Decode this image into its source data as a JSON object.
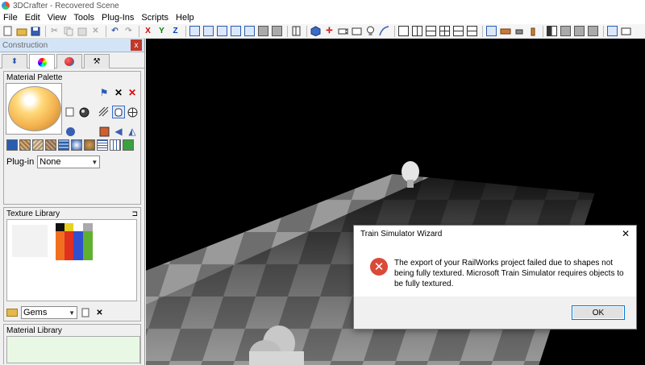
{
  "window": {
    "title": "3DCrafter - Recovered Scene"
  },
  "menu": [
    "File",
    "Edit",
    "View",
    "Tools",
    "Plug-Ins",
    "Scripts",
    "Help"
  ],
  "toolbar": {
    "buttons": [
      "new-icon",
      "open-icon",
      "save-icon",
      "cut-icon",
      "copy-icon",
      "paste-icon",
      "delete-icon",
      "undo-icon",
      "redo-icon"
    ],
    "axes": {
      "x": "X",
      "y": "Y",
      "z": "Z"
    },
    "colors": {
      "x": "#d40000",
      "y": "#008000",
      "z": "#0040c0"
    }
  },
  "panel": {
    "title": "Construction",
    "close": "x",
    "material_palette": {
      "label": "Material Palette",
      "plugin_label": "Plug-in",
      "plugin_value": "None"
    },
    "texture_library": {
      "label": "Texture Library",
      "selected": "Gems"
    },
    "material_library": {
      "label": "Material Library"
    }
  },
  "dialog": {
    "title": "Train Simulator Wizard",
    "close": "✕",
    "message": "The export of your RailWorks project failed due to shapes not being fully textured. Microsoft Train Simulator requires objects to be fully textured.",
    "ok": "OK"
  }
}
